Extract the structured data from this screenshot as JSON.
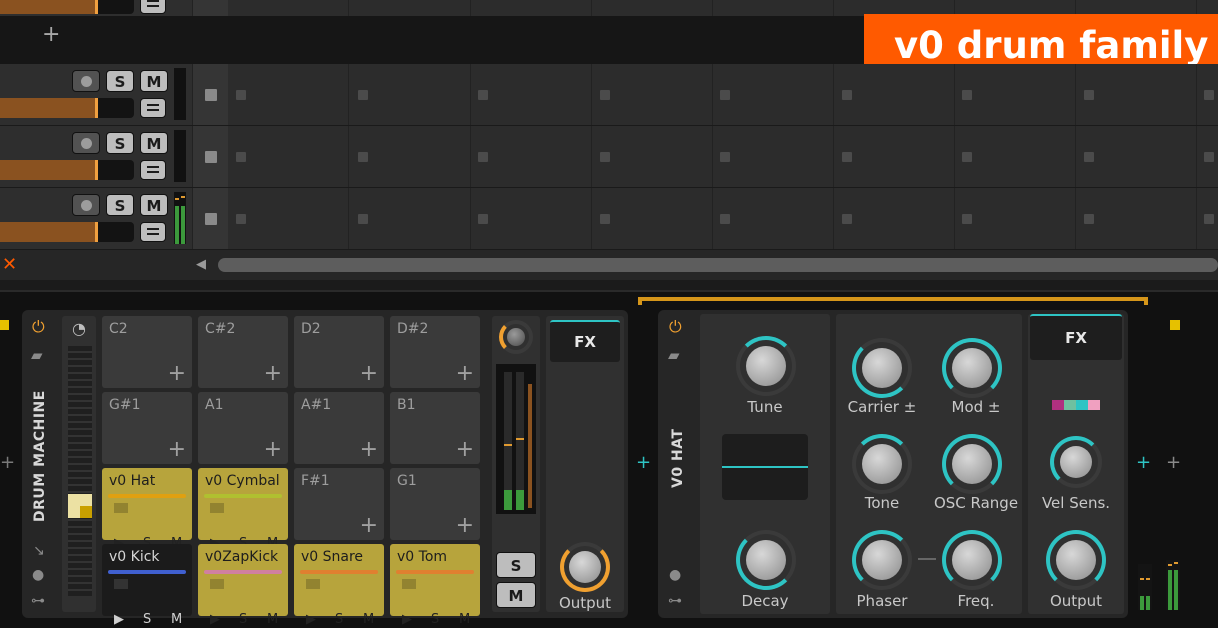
{
  "banner": {
    "title": "v0 drum family"
  },
  "arranger": {
    "add_track_symbol": "+",
    "tracks": [
      {
        "solo": "S",
        "mute": "M"
      },
      {
        "solo": "S",
        "mute": "M"
      },
      {
        "solo": "S",
        "mute": "M"
      }
    ],
    "close_symbol": "✕",
    "scroll_left_symbol": "◀"
  },
  "drum_machine": {
    "title": "DRUM MACHINE",
    "pads": [
      {
        "name": "C2",
        "plus": "+"
      },
      {
        "name": "C#2",
        "plus": "+"
      },
      {
        "name": "D2",
        "plus": "+"
      },
      {
        "name": "D#2",
        "plus": "+"
      },
      {
        "name": "G#1",
        "plus": "+"
      },
      {
        "name": "A1",
        "plus": "+"
      },
      {
        "name": "A#1",
        "plus": "+"
      },
      {
        "name": "B1",
        "plus": "+"
      },
      {
        "name": "v0 Hat"
      },
      {
        "name": "v0 Cymbal"
      },
      {
        "name": "F#1",
        "plus": "+"
      },
      {
        "name": "G1",
        "plus": "+"
      },
      {
        "name": "v0 Kick"
      },
      {
        "name": "v0ZapKick"
      },
      {
        "name": "v0 Snare"
      },
      {
        "name": "v0 Tom"
      }
    ],
    "pad_play": "▶",
    "pad_solo": "S",
    "pad_mute": "M",
    "solo": "S",
    "mute": "M",
    "fx_label": "FX",
    "output_label": "Output"
  },
  "v0_hat": {
    "title": "V0 HAT",
    "knobs": {
      "tune": "Tune",
      "decay": "Decay",
      "carrier": "Carrier ±",
      "mod": "Mod ±",
      "tone": "Tone",
      "osc_range": "OSC Range",
      "phaser": "Phaser",
      "freq": "Freq.",
      "vel_sens": "Vel Sens.",
      "output": "Output"
    },
    "fx_label": "FX"
  },
  "side_plus": "+",
  "colors": {
    "accent_orange": "#ff5a00",
    "teal": "#2ec4c4",
    "pad_yellow": "#b7a43c",
    "power": "#f0a030"
  }
}
